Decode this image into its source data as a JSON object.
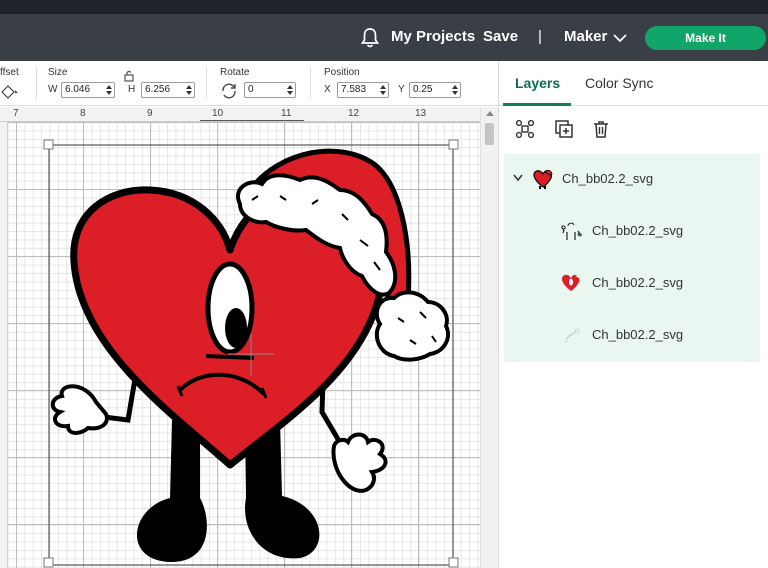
{
  "header": {
    "my_projects": "My Projects",
    "save": "Save",
    "separator": "|",
    "machine": "Maker",
    "make_it": "Make It"
  },
  "toolbar": {
    "offset_label": "ffset",
    "size_label": "Size",
    "w_label": "W",
    "w_value": "6.046",
    "h_label": "H",
    "h_value": "6.256",
    "rotate_label": "Rotate",
    "rotate_value": "0",
    "position_label": "Position",
    "x_label": "X",
    "x_value": "7.583",
    "y_label": "Y",
    "y_value": "0.25"
  },
  "ruler": {
    "ticks": [
      "7",
      "8",
      "9",
      "10",
      "11",
      "12",
      "13"
    ]
  },
  "panel": {
    "tabs": [
      {
        "label": "Layers",
        "active": true
      },
      {
        "label": "Color Sync",
        "active": false
      }
    ],
    "tools": [
      "ungroup-icon",
      "duplicate-icon",
      "delete-icon"
    ],
    "layers": [
      {
        "name": "Ch_bb02.2_svg",
        "level": "group"
      },
      {
        "name": "Ch_bb02.2_svg",
        "level": "child"
      },
      {
        "name": "Ch_bb02.2_svg",
        "level": "child"
      },
      {
        "name": "Ch_bb02.2_svg",
        "level": "child"
      }
    ]
  },
  "colors": {
    "header_bg": "#3a3f45",
    "accent_green": "#12a56a",
    "heart_red": "#dc1e26",
    "layers_highlight": "#eaf7f1"
  }
}
